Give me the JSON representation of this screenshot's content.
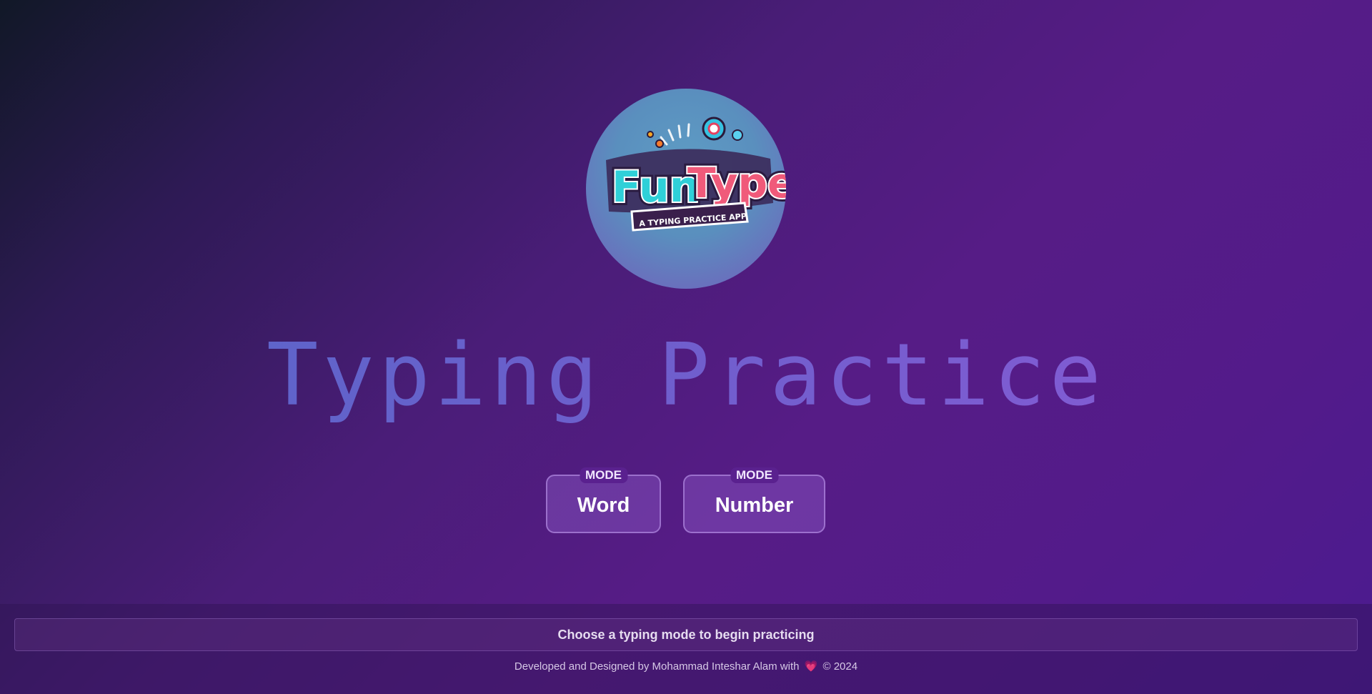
{
  "logo": {
    "title_left": "Fun",
    "title_right": "Type",
    "subtitle": "A TYPING PRACTICE APP"
  },
  "headline": "Typing Practice",
  "modes": [
    {
      "tag": "MODE",
      "label": "Word"
    },
    {
      "tag": "MODE",
      "label": "Number"
    }
  ],
  "footer": {
    "status": "Choose a typing mode to begin practicing",
    "credit_prefix": "Developed and Designed by Mohammad Inteshar Alam with",
    "heart": "💗",
    "credit_suffix": "© 2024"
  },
  "colors": {
    "accent": "#561c86",
    "headline_start": "#5467c8",
    "headline_end": "#8a5ad6",
    "heart": "#e0457b"
  }
}
